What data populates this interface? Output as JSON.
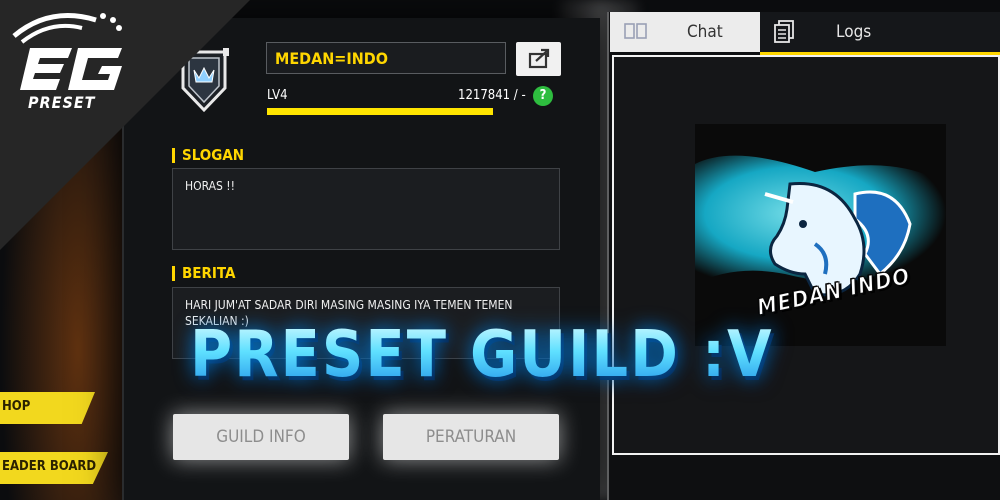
{
  "brand": {
    "logo_text": "PRESET"
  },
  "side_menu": {
    "items": [
      {
        "label": "HOP"
      },
      {
        "label": "EADER BOARD"
      }
    ]
  },
  "guild": {
    "name": "MEDAN=INDO",
    "level": "LV4",
    "exp_text": "1217841 / -",
    "xp_progress": 1.0,
    "help_label": "?",
    "slogan_label": "SLOGAN",
    "slogan_text": "HORAS !!",
    "news_label": "BERITA",
    "news_text": "HARI JUM'AT SADAR DIRI MASING MASING IYA TEMEN TEMEN SEKALIAN :)",
    "buttons": {
      "info": "GUILD INFO",
      "rules": "PERATURAN"
    }
  },
  "chat_panel": {
    "tabs": [
      {
        "label": "Chat",
        "icon": "chat-icon",
        "active": true
      },
      {
        "label": "Logs",
        "icon": "logs-icon",
        "active": false
      }
    ],
    "image_caption": "MEDAN INDO"
  },
  "overlay": {
    "title": "PRESET GUILD :V"
  },
  "colors": {
    "accent_yellow": "#ffd600",
    "help_green": "#2ebd3f",
    "overlay_blue": "#5fe0ff"
  }
}
